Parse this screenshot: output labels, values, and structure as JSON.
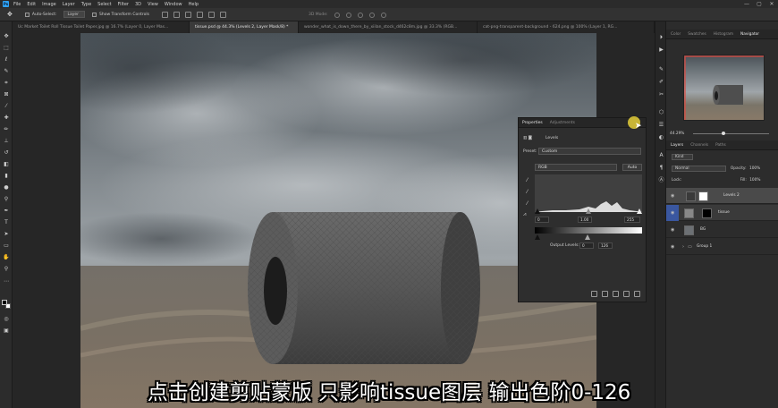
{
  "app": {
    "logo": "Ps"
  },
  "menu": [
    "File",
    "Edit",
    "Image",
    "Layer",
    "Type",
    "Select",
    "Filter",
    "3D",
    "View",
    "Window",
    "Help"
  ],
  "options_bar": {
    "auto_select_label": "Auto-Select:",
    "auto_select_value": "Layer",
    "transform_label": "Show Transform Controls",
    "mode_3d_label": "3D Mode:"
  },
  "tabs": [
    {
      "label": "Uc Market Toilet Roll Tissue Toilet Paper.jpg @ 16.7% (Layer 0, Layer Mas..."
    },
    {
      "label": "tissue.psd @ 44.3% (Levels 2, Layer Mask/8) *",
      "active": true
    },
    {
      "label": "wonder_what_is_down_there_by_xiilan_stock_d462c8m.jpg @ 33.3% (RGB..."
    },
    {
      "label": "cat-png-transparent-background - 624.png @ 100% (Layer 1, RG..."
    }
  ],
  "properties": {
    "tab_properties": "Properties",
    "tab_adjustments": "Adjustments",
    "adjustment_name": "Levels",
    "preset_label": "Preset:",
    "preset_value": "Custom",
    "channel_value": "RGB",
    "auto_label": "Auto",
    "input_black": "0",
    "input_gamma": "1.00",
    "input_white": "255",
    "output_label": "Output Levels:",
    "output_black": "0",
    "output_white": "126"
  },
  "right_panel": {
    "top_tabs": [
      "Color",
      "Swatches",
      "Histogram",
      "Navigator"
    ],
    "active_top_tab": "Navigator",
    "zoom": "44.29%",
    "layer_tabs": [
      "Layers",
      "Channels",
      "Paths"
    ],
    "kind_label": "Kind",
    "blend_mode": "Normal",
    "opacity_label": "Opacity:",
    "opacity_value": "100%",
    "lock_label": "Lock:",
    "fill_label": "Fill:",
    "fill_value": "100%",
    "layers": [
      {
        "name": "Levels 2",
        "selected": true
      },
      {
        "name": "tissue"
      },
      {
        "name": "BG"
      },
      {
        "name": "Group 1"
      }
    ]
  },
  "subtitle": "点击创建剪贴蒙版 只影响tissue图层 输出色阶0-126",
  "colors": {
    "accent": "#2fa3f7",
    "ui_bg": "#2c2c2c",
    "panel_dark": "#262626",
    "selected_layer": "#4a4a4a"
  }
}
